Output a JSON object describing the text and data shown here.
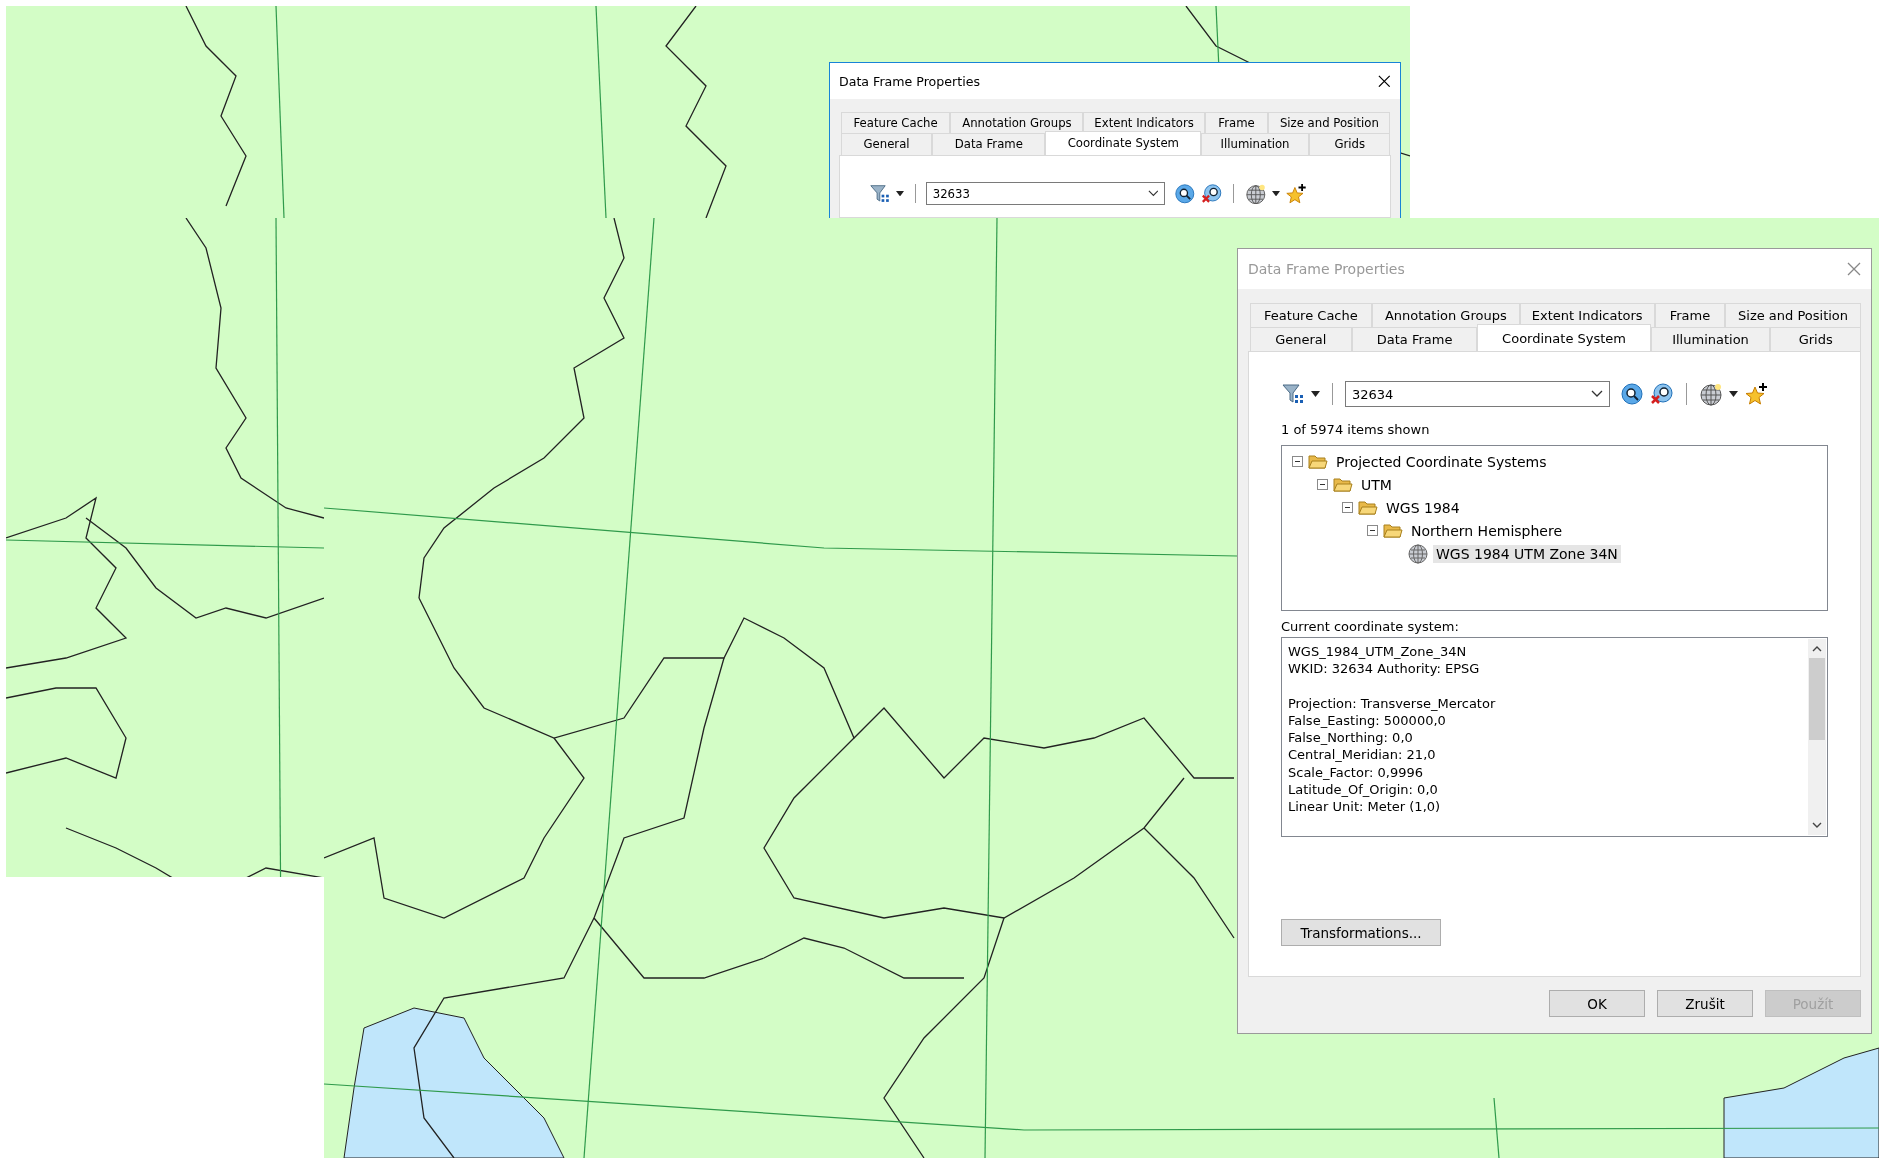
{
  "dialogs": [
    {
      "title": "Data Frame Properties",
      "active": true,
      "tab_rows": [
        [
          {
            "label": "Feature Cache",
            "selected": false
          },
          {
            "label": "Annotation Groups",
            "selected": false
          },
          {
            "label": "Extent Indicators",
            "selected": false
          },
          {
            "label": "Frame",
            "selected": false
          },
          {
            "label": "Size and Position",
            "selected": false
          }
        ],
        [
          {
            "label": "General",
            "selected": false
          },
          {
            "label": "Data Frame",
            "selected": false
          },
          {
            "label": "Coordinate System",
            "selected": true
          },
          {
            "label": "Illumination",
            "selected": false
          },
          {
            "label": "Grids",
            "selected": false
          }
        ]
      ],
      "search": {
        "value": "32633"
      }
    },
    {
      "title": "Data Frame Properties",
      "active": false,
      "tab_rows": [
        [
          {
            "label": "Feature Cache",
            "selected": false
          },
          {
            "label": "Annotation Groups",
            "selected": false
          },
          {
            "label": "Extent Indicators",
            "selected": false
          },
          {
            "label": "Frame",
            "selected": false
          },
          {
            "label": "Size and Position",
            "selected": false
          }
        ],
        [
          {
            "label": "General",
            "selected": false
          },
          {
            "label": "Data Frame",
            "selected": false
          },
          {
            "label": "Coordinate System",
            "selected": true
          },
          {
            "label": "Illumination",
            "selected": false
          },
          {
            "label": "Grids",
            "selected": false
          }
        ]
      ],
      "search": {
        "value": "32634"
      },
      "items_shown": "1 of 5974 items shown",
      "tree": [
        {
          "label": "Projected Coordinate Systems",
          "kind": "folder",
          "expanded": true,
          "selected": false,
          "children": [
            {
              "label": "UTM",
              "kind": "folder",
              "expanded": true,
              "selected": false,
              "children": [
                {
                  "label": "WGS 1984",
                  "kind": "folder",
                  "expanded": true,
                  "selected": false,
                  "children": [
                    {
                      "label": "Northern Hemisphere",
                      "kind": "folder",
                      "expanded": true,
                      "selected": false,
                      "children": [
                        {
                          "label": "WGS 1984 UTM Zone 34N",
                          "kind": "crs",
                          "selected": true
                        }
                      ]
                    }
                  ]
                }
              ]
            }
          ]
        }
      ],
      "current_label": "Current coordinate system:",
      "description": [
        [
          "WGS_1984_UTM_Zone_34N",
          "WKID: 32634 Authority: EPSG"
        ],
        [
          "Projection: Transverse_Mercator",
          "False_Easting: 500000,0",
          "False_Northing: 0,0",
          "Central_Meridian: 21,0",
          "Scale_Factor: 0,9996",
          "Latitude_Of_Origin: 0,0",
          "Linear Unit: Meter (1,0)"
        ]
      ],
      "transformations_button": "Transformations...",
      "buttons": [
        {
          "label": "OK",
          "disabled": false
        },
        {
          "label": "Zrušit",
          "disabled": false
        },
        {
          "label": "Použít",
          "disabled": true
        }
      ]
    }
  ]
}
